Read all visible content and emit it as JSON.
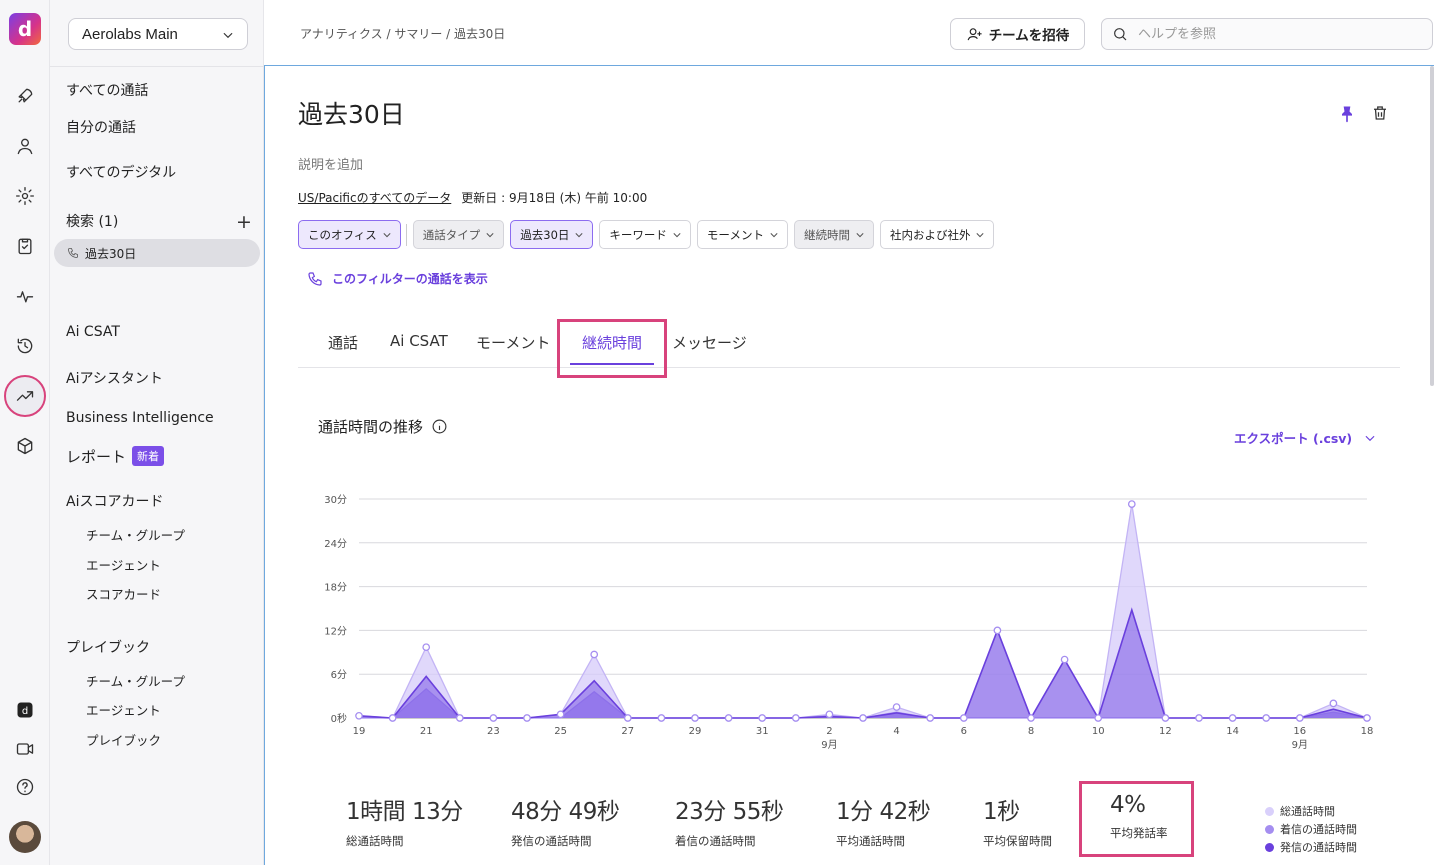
{
  "app": {
    "logo_letter": "d"
  },
  "rail_icons": [
    "rocket-icon",
    "person-icon",
    "gear-icon",
    "clipboard-icon",
    "activity-icon",
    "history-icon",
    "trending-icon",
    "cube-icon",
    "dialpad-app-icon",
    "video-icon",
    "help-circle-icon"
  ],
  "workspace": {
    "name": "Aerolabs Main"
  },
  "sidebar": {
    "all_calls": "すべての通話",
    "my_calls": "自分の通話",
    "all_digital": "すべてのデジタル",
    "search_header": "検索 (1)",
    "saved_search": "過去30日",
    "ai_csat": "Ai CSAT",
    "ai_assistant": "Aiアシスタント",
    "bi": "Business Intelligence",
    "reports": "レポート",
    "reports_badge": "新着",
    "ai_scorecard": "Aiスコアカード",
    "scorecard_items": [
      "チーム・グループ",
      "エージェント",
      "スコアカード"
    ],
    "playbook": "プレイブック",
    "playbook_items": [
      "チーム・グループ",
      "エージェント",
      "プレイブック"
    ]
  },
  "header": {
    "breadcrumb": "アナリティクス / サマリー / 過去30日",
    "invite_label": "チームを招待",
    "help_placeholder": "ヘルプを参照"
  },
  "page": {
    "title": "過去30日",
    "add_description": "説明を追加",
    "timezone_link": "US/Pacificのすべてのデータ",
    "updated": "更新日 : 9月18日 (木) 午前 10:00",
    "show_calls": "このフィルターの通話を表示"
  },
  "filters": [
    {
      "label": "このオフィス",
      "state": "selected"
    },
    {
      "label": "通話タイプ",
      "state": "disabled"
    },
    {
      "label": "過去30日",
      "state": "selected"
    },
    {
      "label": "キーワード",
      "state": "normal"
    },
    {
      "label": "モーメント",
      "state": "normal"
    },
    {
      "label": "継続時間",
      "state": "disabled"
    },
    {
      "label": "社内および社外",
      "state": "normal"
    }
  ],
  "tabs": [
    "通話",
    "Ai CSAT",
    "モーメント",
    "継続時間",
    "メッセージ"
  ],
  "active_tab": "継続時間",
  "chart_section": {
    "title": "通話時間の推移",
    "export_label": "エクスポート (.csv)"
  },
  "colors": {
    "accent": "#6a40dd",
    "highlight": "#d8437c",
    "total": "#d9d0fb",
    "inbound": "#a58ef0",
    "outbound": "#6a40dd"
  },
  "chart_data": {
    "type": "area",
    "x": [
      "19",
      "20",
      "21",
      "22",
      "23",
      "24",
      "25",
      "26",
      "27",
      "28",
      "29",
      "30",
      "31",
      "1",
      "2",
      "3",
      "4",
      "5",
      "6",
      "7",
      "8",
      "9",
      "10",
      "11",
      "12",
      "13",
      "14",
      "15",
      "16",
      "17",
      "18"
    ],
    "x_tick_labels": [
      "19",
      "21",
      "23",
      "25",
      "27",
      "29",
      "31",
      "2",
      "4",
      "6",
      "8",
      "10",
      "12",
      "14",
      "16",
      "18"
    ],
    "x_sublabels": [
      {
        "at": "2",
        "text": "9月"
      },
      {
        "at": "16",
        "text": "9月"
      }
    ],
    "y_ticks": [
      "0秒",
      "6分",
      "12分",
      "18分",
      "24分",
      "30分"
    ],
    "ylim": [
      0,
      30
    ],
    "y_unit": "分",
    "series": [
      {
        "name": "総通話時間",
        "values": [
          0.3,
          0,
          9.7,
          0,
          0,
          0,
          0.5,
          8.7,
          0,
          0,
          0,
          0,
          0,
          0,
          0.5,
          0,
          1.5,
          0,
          0,
          12.0,
          0,
          8.0,
          0,
          29.3,
          0,
          0,
          0,
          0,
          0,
          2.0,
          0
        ]
      },
      {
        "name": "着信の通話時間",
        "values": [
          0,
          0,
          4,
          0,
          0,
          0,
          0,
          3.6,
          0,
          0,
          0,
          0,
          0,
          0,
          0.3,
          0,
          0.8,
          0,
          0,
          0,
          0,
          0,
          0,
          0,
          0,
          0,
          0,
          0,
          0,
          0.8,
          0
        ]
      },
      {
        "name": "発信の通話時間",
        "values": [
          0.3,
          0,
          5.7,
          0,
          0,
          0,
          0.5,
          5.1,
          0,
          0,
          0,
          0,
          0,
          0,
          0.2,
          0,
          0.7,
          0,
          0,
          12.0,
          0,
          8.0,
          0,
          14.8,
          0,
          0,
          0,
          0,
          0,
          1.2,
          0
        ]
      }
    ],
    "grid": true,
    "legend": "bottom-right"
  },
  "stats": [
    {
      "value": "1時間 13分",
      "label": "総通話時間"
    },
    {
      "value": "48分 49秒",
      "label": "発信の通話時間"
    },
    {
      "value": "23分 55秒",
      "label": "着信の通話時間"
    },
    {
      "value": "1分 42秒",
      "label": "平均通話時間"
    },
    {
      "value": "1秒",
      "label": "平均保留時間"
    },
    {
      "value": "4%",
      "label": "平均発話率"
    }
  ]
}
